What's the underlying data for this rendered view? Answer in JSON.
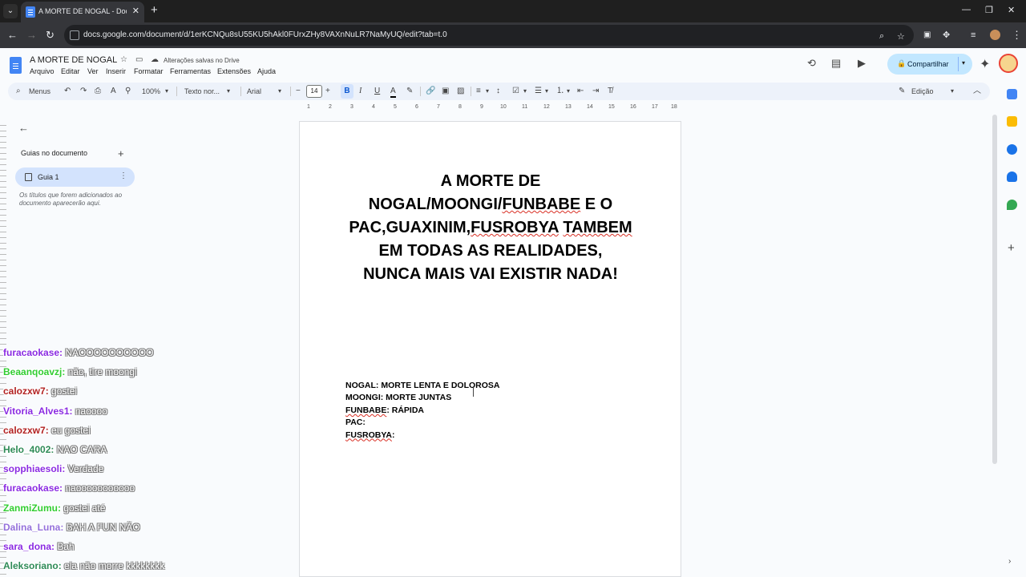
{
  "browser": {
    "tab_title": "A MORTE DE NOGAL - Documentos",
    "url": "docs.google.com/document/d/1erKCNQu8sU55KU5hAkl0FUrxZHy8VAXnNuLR7NaMyUQ/edit?tab=t.0"
  },
  "docs": {
    "title": "A MORTE DE NOGAL",
    "save_status": "Alterações salvas no Drive",
    "menu": [
      "Arquivo",
      "Editar",
      "Ver",
      "Inserir",
      "Formatar",
      "Ferramentas",
      "Extensões",
      "Ajuda"
    ],
    "share_label": "Compartilhar"
  },
  "toolbar": {
    "search_label": "Menus",
    "zoom": "100%",
    "style": "Texto nor...",
    "font": "Arial",
    "font_size": "14",
    "bold": "B",
    "italic": "I",
    "underline": "U",
    "text_color": "A",
    "mode": "Edição"
  },
  "ruler": [
    "1",
    "2",
    "3",
    "4",
    "5",
    "6",
    "7",
    "8",
    "9",
    "10",
    "11",
    "12",
    "13",
    "14",
    "15",
    "16",
    "17",
    "18"
  ],
  "outline": {
    "header": "Guias no documento",
    "guide_label": "Guia 1",
    "hint": "Os títulos que forem adicionados ao documento aparecerão aqui."
  },
  "document": {
    "heading_parts": [
      "A MORTE DE NOGAL/MOONGI/",
      "FUNBABE",
      " E O PAC,GUAXINIM,",
      "FUSROBYA",
      " ",
      "TAMBEM",
      " EM TODAS AS REALIDADES, NUNCA MAIS VAI EXISTIR NADA!"
    ],
    "list": {
      "l1": "NOGAL: MORTE LENTA E DOLOROSA",
      "l2": "MOONGI: MORTE JUNTAS",
      "l3_name": "FUNBABE",
      "l3_rest": ": RÁPIDA",
      "l4": "PAC:",
      "l5_name": "FUSROBYA",
      "l5_rest": ":"
    }
  },
  "chat": [
    {
      "user": "furacaokase:",
      "msg": "NAOOOOOOOOOO",
      "color": "#8a2be2"
    },
    {
      "user": "Beaanqoavzj:",
      "msg": "não, tire moongi",
      "color": "#32cd32"
    },
    {
      "user": "calozxw7:",
      "msg": "gostei",
      "color": "#b22222"
    },
    {
      "user": "Vitoria_Alves1:",
      "msg": "naoooo",
      "color": "#8a2be2"
    },
    {
      "user": "calozxw7:",
      "msg": "eu gostei",
      "color": "#b22222"
    },
    {
      "user": "Helo_4002:",
      "msg": "NAO CARA",
      "color": "#2e8b57"
    },
    {
      "user": "sopphiaesoli:",
      "msg": "Verdade",
      "color": "#8a2be2"
    },
    {
      "user": "furacaokase:",
      "msg": "naooooooooooo",
      "color": "#8a2be2"
    },
    {
      "user": "ZanmiZumu:",
      "msg": "gostei até",
      "color": "#32cd32"
    },
    {
      "user": "Dalina_Luna:",
      "msg": "BAH A FUN NÃO",
      "color": "#9370db"
    },
    {
      "user": "sara_dona:",
      "msg": "Bah",
      "color": "#8a2be2"
    },
    {
      "user": "Aleksoriano:",
      "msg": "ela não morre kkkkkkkk",
      "color": "#2e8b57"
    }
  ]
}
